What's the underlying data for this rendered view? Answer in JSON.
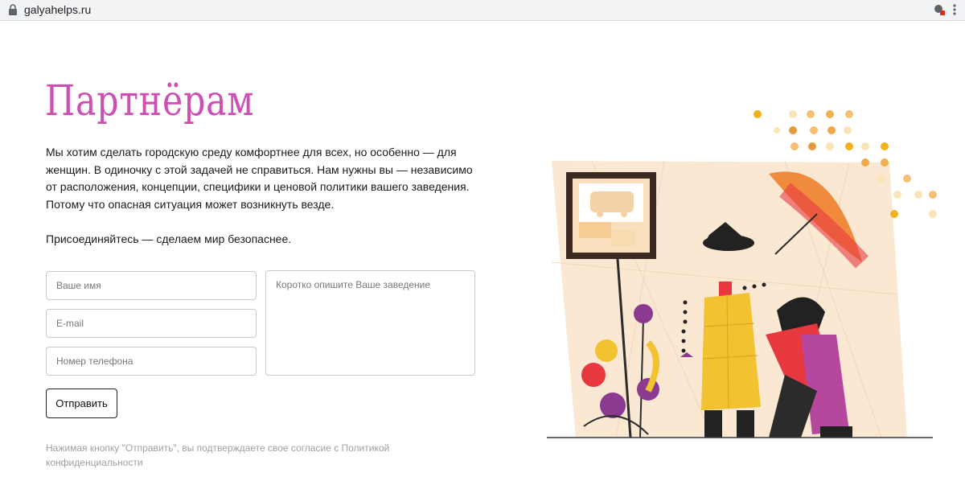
{
  "browser": {
    "url": "galyahelps.ru",
    "icons": {
      "lock": "lock-icon",
      "extension": "extension-icon",
      "menu": "menu-dots-icon"
    }
  },
  "page": {
    "title": "Партнёрам",
    "intro": "Мы хотим сделать городскую среду комфортнее для всех, но особенно — для женщин. В одиночку с этой задачей не справиться. Нам нужны вы — независимо от расположения, концепции, специфики и ценовой политики вашего заведения. Потому что опасная ситуация может возникнуть везде.",
    "cta": "Присоединяйтесь — сделаем мир безопаснее."
  },
  "form": {
    "name_placeholder": "Ваше имя",
    "email_placeholder": "E-mail",
    "phone_placeholder": "Номер телефона",
    "description_placeholder": "Коротко опишите Ваше заведение",
    "submit_label": "Отправить",
    "consent_text": "Нажимая кнопку \"Отправить\", вы подтверждаете свое согласие с Политикой конфиденциальности"
  },
  "colors": {
    "title": "#cc4fb3",
    "accent_orange": "#f08a3c",
    "accent_red": "#e8383f",
    "accent_yellow": "#f2c230",
    "accent_purple": "#8a3b8f"
  },
  "illustration": {
    "name": "bus-stop-umbrella-illustration"
  }
}
